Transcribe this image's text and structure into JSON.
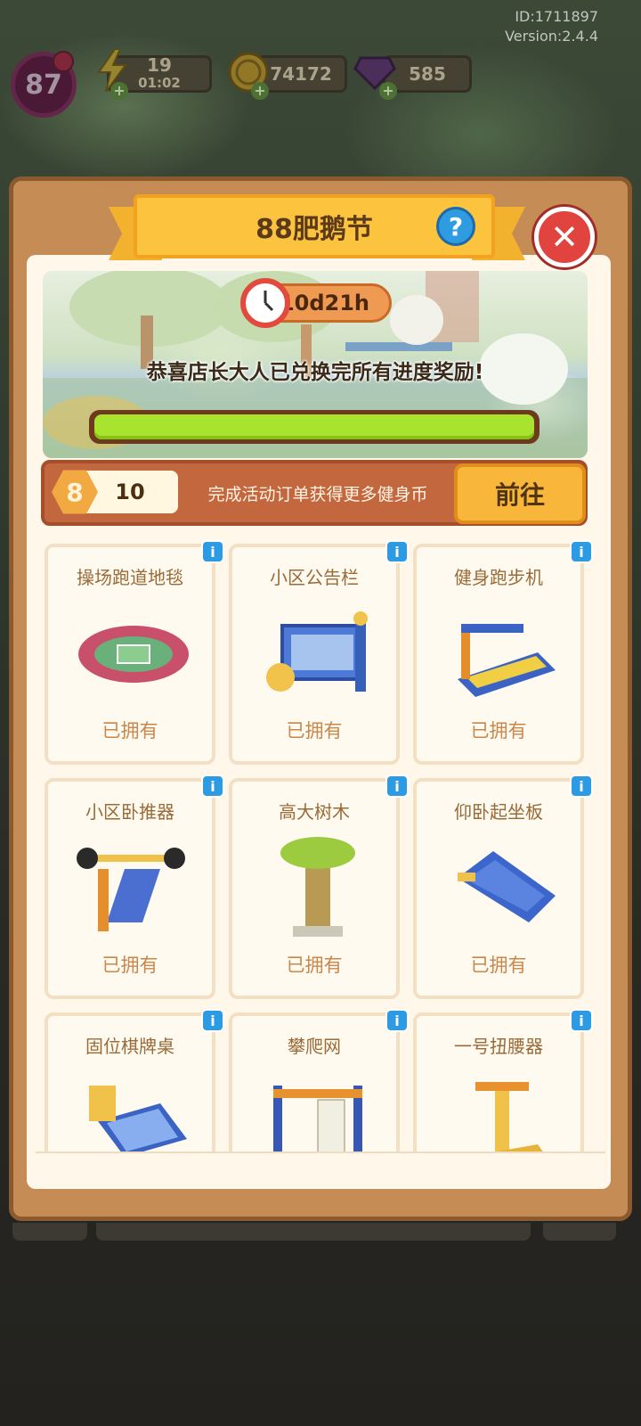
{
  "meta": {
    "id_text": "ID:1711897",
    "version_text": "Version:2.4.4"
  },
  "hud": {
    "level": "87",
    "energy": {
      "value": "19",
      "timer": "01:02"
    },
    "coins": "74172",
    "gems": "585"
  },
  "event": {
    "title": "88肥鹅节",
    "timer": "10d21h",
    "message": "恭喜店长大人已兑换完所有进度奖励!",
    "progress": 1.0
  },
  "currency": {
    "badge": "8",
    "amount": "10",
    "description": "完成活动订单获得更多健身币",
    "go_label": "前往"
  },
  "items": [
    {
      "name": "操场跑道地毯",
      "status": "已拥有",
      "icon": "track-carpet-icon"
    },
    {
      "name": "小区公告栏",
      "status": "已拥有",
      "icon": "bulletin-board-icon"
    },
    {
      "name": "健身跑步机",
      "status": "已拥有",
      "icon": "treadmill-icon"
    },
    {
      "name": "小区卧推器",
      "status": "已拥有",
      "icon": "bench-press-icon"
    },
    {
      "name": "高大树木",
      "status": "已拥有",
      "icon": "tall-tree-icon"
    },
    {
      "name": "仰卧起坐板",
      "status": "已拥有",
      "icon": "situp-board-icon"
    },
    {
      "name": "固位棋牌桌",
      "status": "",
      "icon": "chess-table-icon"
    },
    {
      "name": "攀爬网",
      "status": "",
      "icon": "climbing-net-icon"
    },
    {
      "name": "一号扭腰器",
      "status": "",
      "icon": "waist-twister-icon"
    }
  ],
  "colors": {
    "panel": "#c58c56",
    "banner": "#fcc33f",
    "progress_fill": "#a8e32e",
    "close": "#e1443e",
    "info": "#2c9be4"
  }
}
